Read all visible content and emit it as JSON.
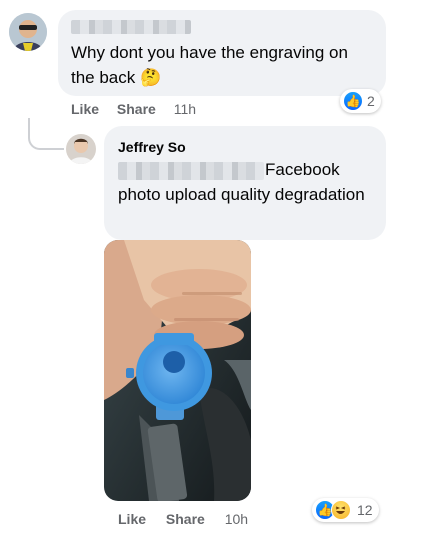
{
  "comment1": {
    "text": "Why dont you have the engraving on the back",
    "emoji": "🤔",
    "actions": {
      "like": "Like",
      "share": "Share",
      "time": "11h"
    },
    "reaction_count": "2"
  },
  "reply1": {
    "author": "Jeffrey So",
    "text": "Facebook photo upload quality degradation",
    "actions": {
      "like": "Like",
      "share": "Share",
      "time": "10h"
    },
    "reaction_count": "12"
  },
  "icons": {
    "like": "thumbs-up-icon",
    "haha": "laughing-face-icon"
  },
  "colors": {
    "bubble": "#f0f2f5",
    "like_blue": "#0866ff",
    "meta_gray": "#65676b",
    "watch_blue": "#3f98e0"
  }
}
